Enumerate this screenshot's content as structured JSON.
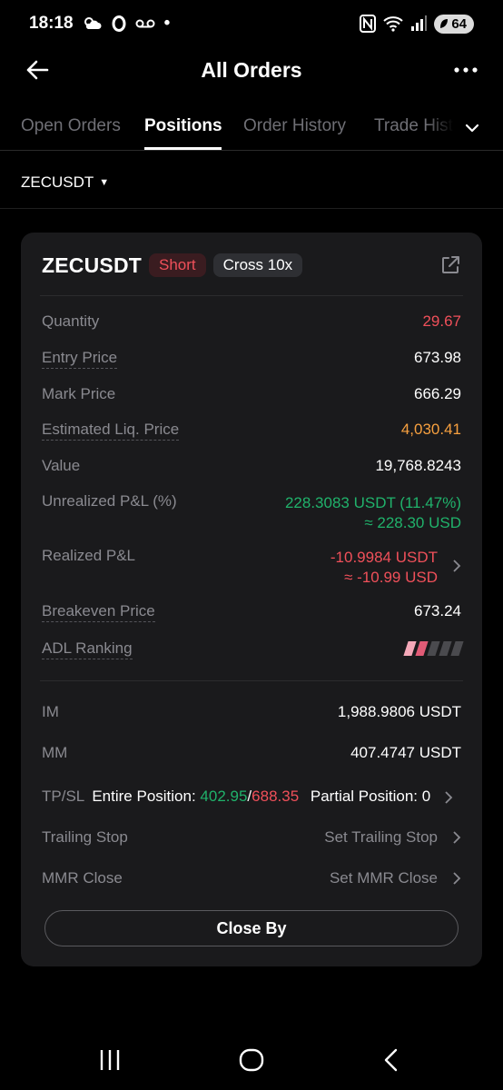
{
  "status_bar": {
    "time": "18:18",
    "dot": "•",
    "battery": "64"
  },
  "header": {
    "title": "All Orders"
  },
  "tabs": [
    {
      "label": "Open Orders"
    },
    {
      "label": "Positions"
    },
    {
      "label": "Order History"
    },
    {
      "label": "Trade History"
    }
  ],
  "filter": {
    "symbol": "ZECUSDT"
  },
  "position": {
    "symbol": "ZECUSDT",
    "side": "Short",
    "margin_mode": "Cross 10x",
    "rows": [
      {
        "label": "Quantity",
        "value": "29.67"
      },
      {
        "label": "Entry Price",
        "value": "673.98"
      },
      {
        "label": "Mark Price",
        "value": "666.29"
      },
      {
        "label": "Estimated Liq. Price",
        "value": "4,030.41"
      },
      {
        "label": "Value",
        "value": "19,768.8243"
      }
    ],
    "unrealized": {
      "label": "Unrealized P&L (%)",
      "value": "228.3083 USDT (11.47%)",
      "usd": "≈ 228.30 USD"
    },
    "realized": {
      "label": "Realized P&L",
      "value": "-10.9984 USDT",
      "usd": "≈ -10.99 USD"
    },
    "breakeven": {
      "label": "Breakeven Price",
      "value": "673.24"
    },
    "adl": {
      "label": "ADL Ranking",
      "level": 2,
      "max": 5
    },
    "im": {
      "label": "IM",
      "value": "1,988.9806 USDT"
    },
    "mm": {
      "label": "MM",
      "value": "407.4747 USDT"
    },
    "tpsl": {
      "label": "TP/SL",
      "entire_label": "Entire Position:",
      "tp": "402.95",
      "sep": "/",
      "sl": "688.35",
      "partial_label": "Partial Position:",
      "partial_value": "0"
    },
    "trailing": {
      "label": "Trailing Stop",
      "action": "Set Trailing Stop"
    },
    "mmr": {
      "label": "MMR Close",
      "action": "Set MMR Close"
    },
    "close_by": "Close By"
  },
  "colors": {
    "red": "#f0505a",
    "green": "#20b26b",
    "orange": "#f7a03f",
    "card": "#1a1a1c"
  }
}
